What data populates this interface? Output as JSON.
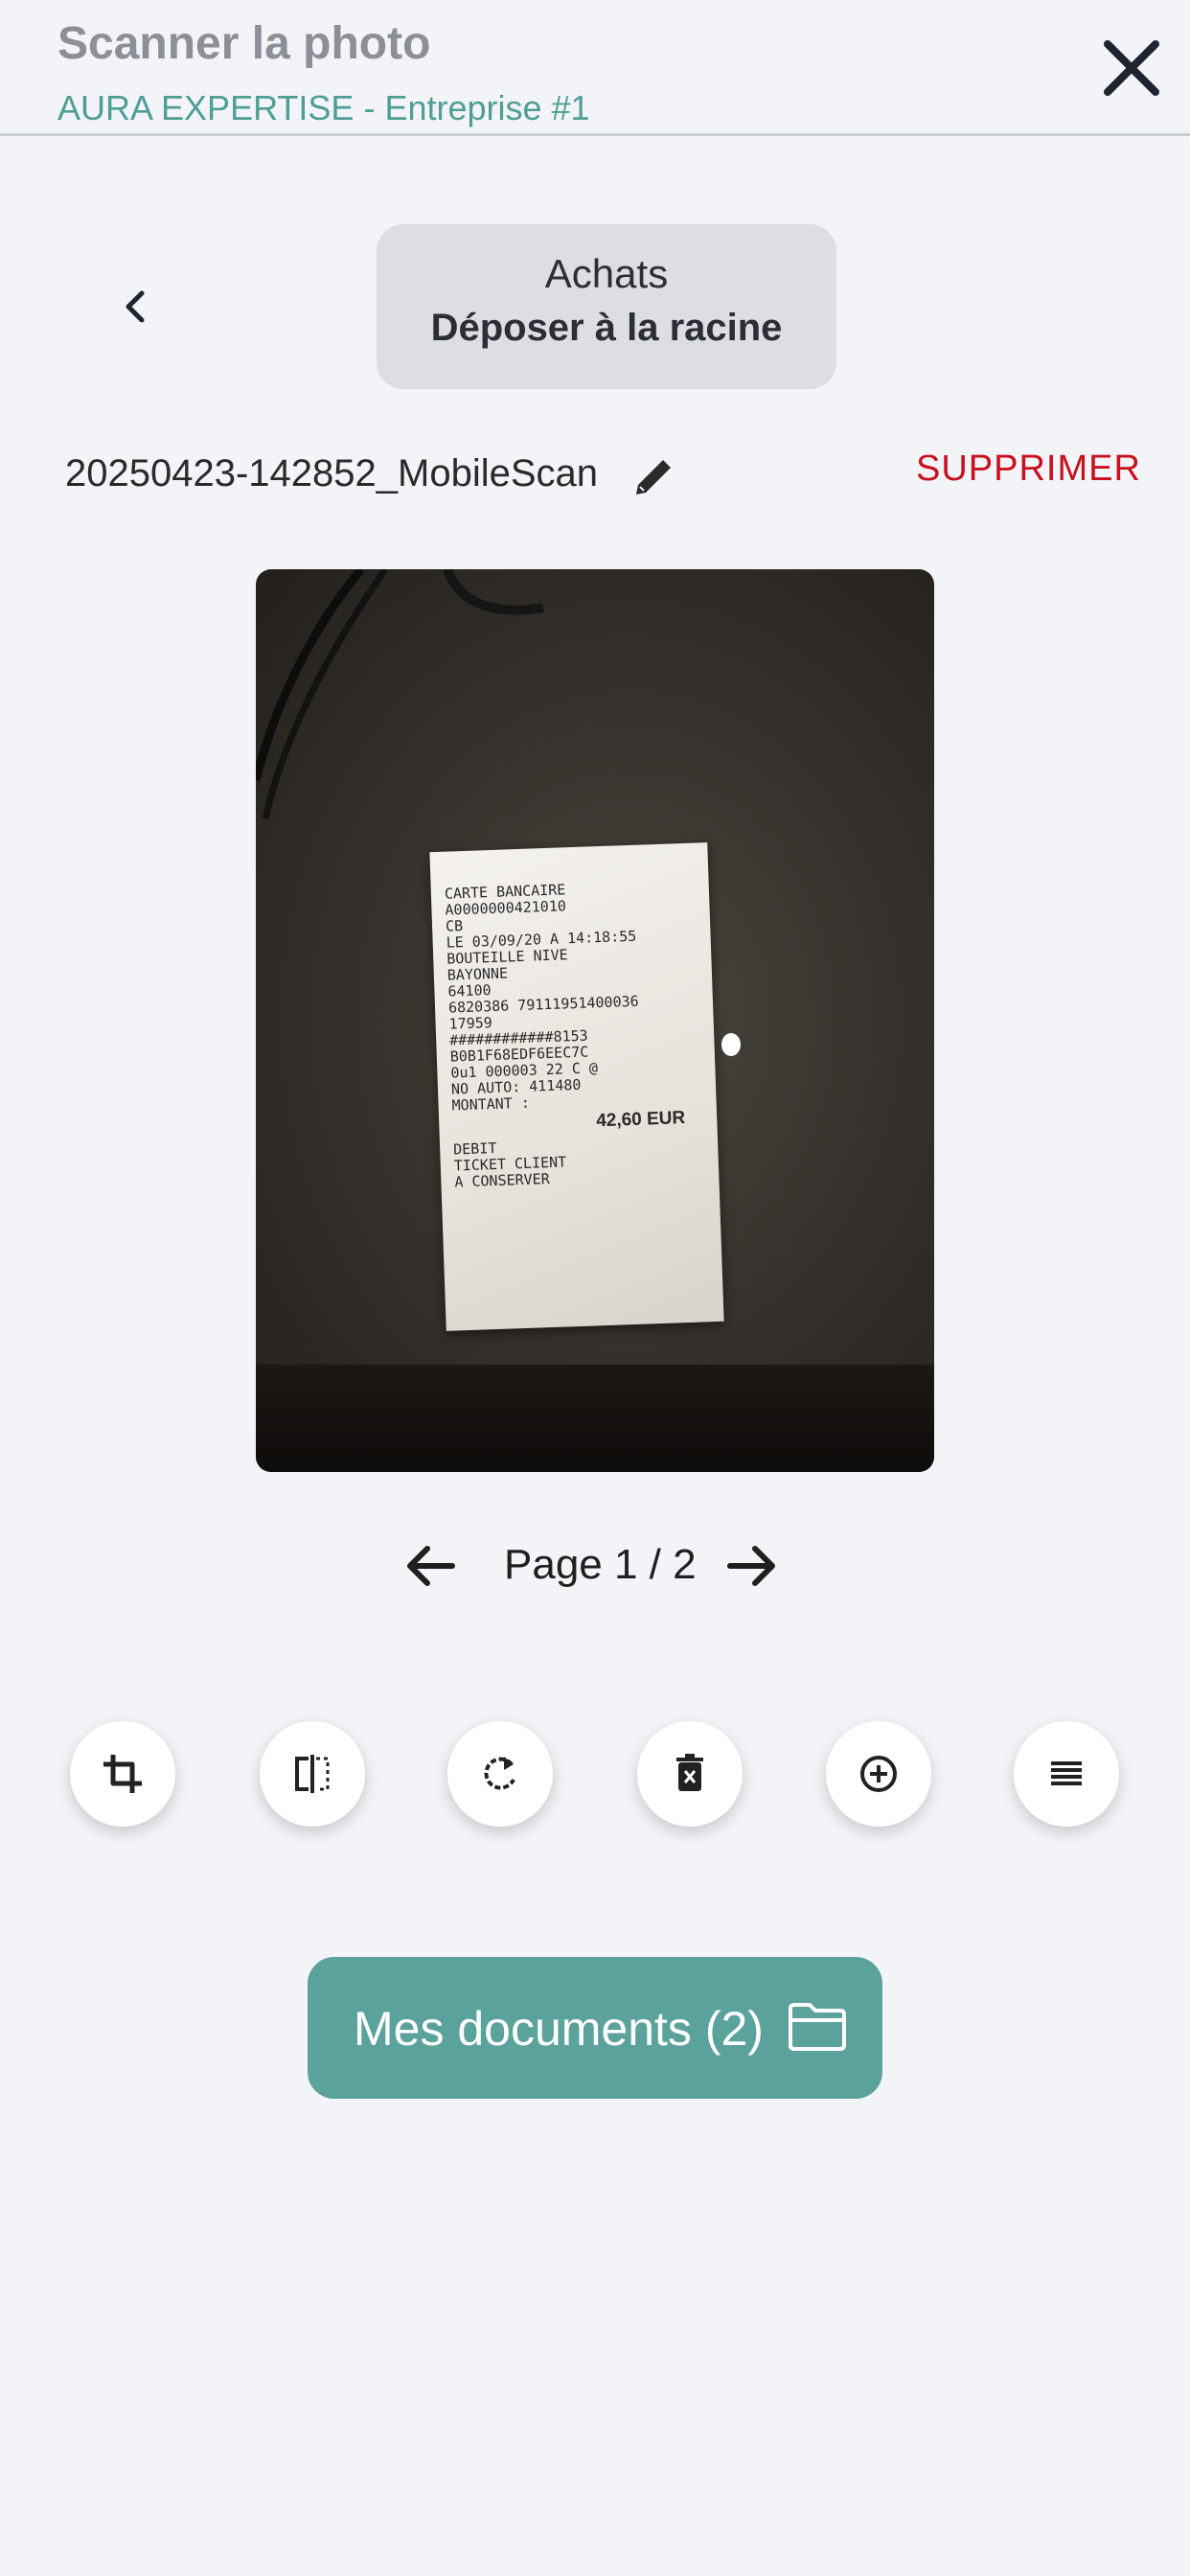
{
  "header": {
    "title": "Scanner la photo",
    "subtitle": "AURA EXPERTISE - Entreprise #1"
  },
  "folder": {
    "category": "Achats",
    "destination": "Déposer à la racine"
  },
  "document": {
    "filename": "20250423-142852_MobileScan",
    "delete_label": "SUPPRIMER"
  },
  "receipt": {
    "lines": [
      "CARTE BANCAIRE",
      "",
      "A0000000421010",
      "CB",
      "LE 03/09/20 A 14:18:55",
      "BOUTEILLE NIVE",
      "BAYONNE",
      "64100",
      "6820386 79111951400036",
      "17959",
      "############8153",
      "B0B1F68EDF6EEC7C",
      "0u1 000003 22 C @",
      "NO AUTO: 411480",
      "MONTANT :"
    ],
    "amount": "42,60 EUR",
    "footer": [
      "DEBIT",
      "TICKET CLIENT",
      "A CONSERVER"
    ]
  },
  "pager": {
    "label": "Page 1 / 2"
  },
  "toolbar": {
    "tools": [
      "crop-icon",
      "flip-icon",
      "rotate-icon",
      "delete-page-icon",
      "add-page-icon",
      "reorder-icon"
    ]
  },
  "actions": {
    "documents_label": "Mes documents (2)"
  },
  "colors": {
    "accent": "#5aa29b",
    "subtitle": "#4f9e95",
    "danger": "#c8101e",
    "background": "#f2f4f8"
  }
}
